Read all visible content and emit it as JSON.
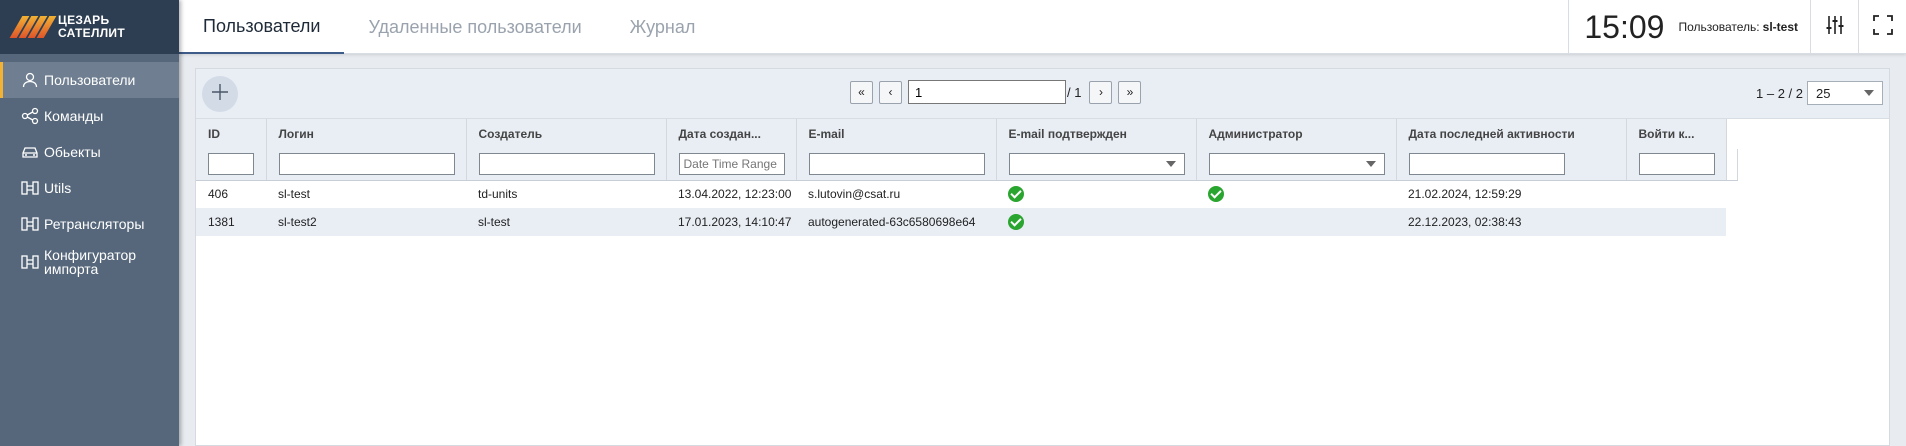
{
  "brand": {
    "line1": "ЦЕЗАРЬ",
    "line2": "САТЕЛЛИТ"
  },
  "sidebar": {
    "items": [
      {
        "label": "Пользователи",
        "icon": "user-icon",
        "active": true
      },
      {
        "label": "Команды",
        "icon": "share-icon",
        "active": false
      },
      {
        "label": "Обьекты",
        "icon": "car-icon",
        "active": false
      },
      {
        "label": "Utils",
        "icon": "transfer-icon",
        "active": false
      },
      {
        "label": "Ретрансляторы",
        "icon": "transfer-icon",
        "active": false
      },
      {
        "label": "Конфигуратор импорта",
        "icon": "transfer-icon",
        "active": false
      }
    ]
  },
  "header": {
    "tabs": [
      {
        "label": "Пользователи",
        "active": true
      },
      {
        "label": "Удаленные пользователи",
        "active": false
      },
      {
        "label": "Журнал",
        "active": false
      }
    ],
    "clock": "15:09",
    "user_label": "Пользователь:",
    "user_name": "sl-test"
  },
  "toolbar": {
    "page_value": "1",
    "page_total": "/ 1",
    "range": "1 – 2 / 2",
    "page_size": "25"
  },
  "table": {
    "columns": [
      "ID",
      "Логин",
      "Создатель",
      "Дата создан...",
      "E-mail",
      "E-mail подтвержден",
      "Администратор",
      "Дата последней активности",
      "Войти к..."
    ],
    "date_filter_placeholder": "Date Time Range",
    "rows": [
      {
        "id": "406",
        "login": "sl-test",
        "creator": "td-units",
        "created": "13.04.2022, 12:23:00",
        "email": "s.lutovin@csat.ru",
        "email_confirmed": true,
        "admin": true,
        "last_active": "21.02.2024, 12:59:29"
      },
      {
        "id": "1381",
        "login": "sl-test2",
        "creator": "sl-test",
        "created": "17.01.2023, 14:10:47",
        "email": "autogenerated-63c6580698e64",
        "email_confirmed": true,
        "admin": false,
        "last_active": "22.12.2023, 02:38:43"
      }
    ]
  },
  "colors": {
    "sidebar": "#56677b",
    "logo_bg": "#2e3e52",
    "accent": "#f2b233",
    "check": "#2aa52f"
  }
}
